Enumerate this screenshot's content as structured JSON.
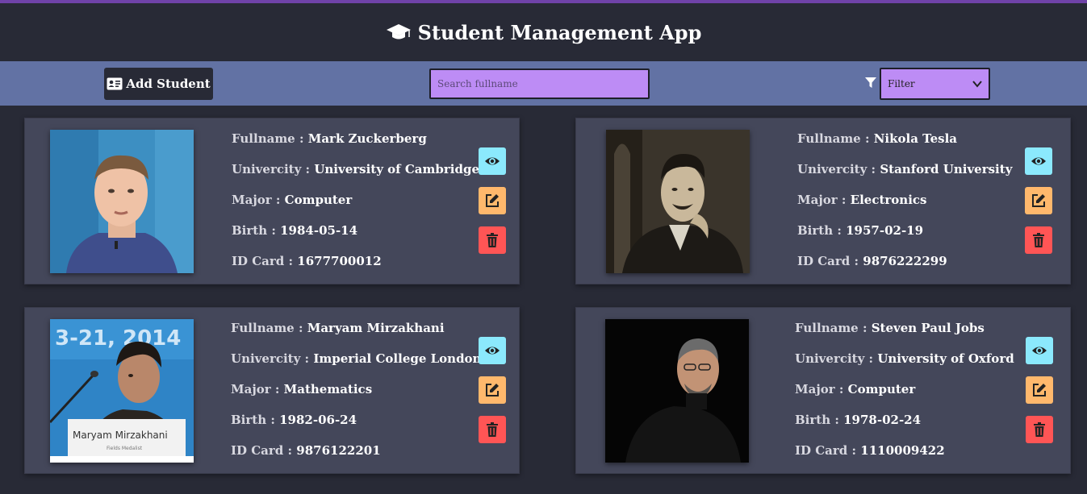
{
  "header": {
    "title": "Student Management App",
    "icon": "graduation-cap-icon"
  },
  "toolbar": {
    "add_label": "Add Student",
    "search_placeholder": "Search fullname",
    "filter_label": "Filter"
  },
  "labels": {
    "fullname": "Fullname : ",
    "university": "Univercity : ",
    "major": "Major : ",
    "birth": "Birth : ",
    "idcard": "ID Card : "
  },
  "students": [
    {
      "fullname": "Mark Zuckerberg",
      "university": "University of Cambridge",
      "major": "Computer",
      "birth": "1984-05-14",
      "idcard": "1677700012"
    },
    {
      "fullname": "Nikola Tesla",
      "university": "Stanford University",
      "major": "Electronics",
      "birth": "1957-02-19",
      "idcard": "9876222299"
    },
    {
      "fullname": "Maryam Mirzakhani",
      "university": "Imperial College London",
      "major": "Mathematics",
      "birth": "1982-06-24",
      "idcard": "9876122201"
    },
    {
      "fullname": "Steven Paul Jobs",
      "university": "University of Oxford",
      "major": "Computer",
      "birth": "1978-02-24",
      "idcard": "1110009422"
    }
  ],
  "photo_lettering": {
    "banner_year": "3-21, 2014",
    "nameplate_name": "Maryam Mirzakhani",
    "nameplate_sub": "Fields Medalist"
  },
  "colors": {
    "background": "#282a36",
    "toolbar": "#6272a4",
    "card": "#44475a",
    "input": "#bd8cf5",
    "view": "#8be9fd",
    "edit": "#ffb86c",
    "delete": "#ff5555"
  }
}
